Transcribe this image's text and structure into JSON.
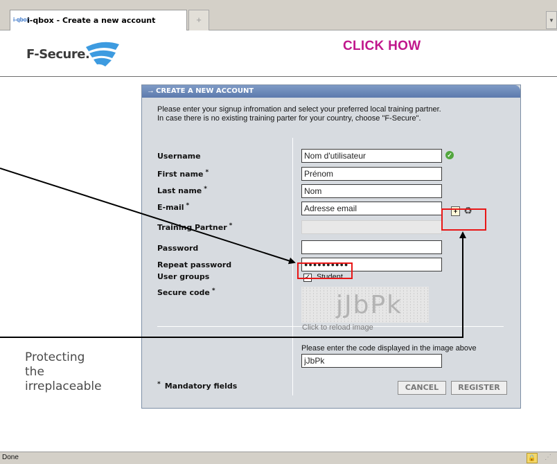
{
  "browser": {
    "tab_title": "i-qbox - Create a new account",
    "tab_favicon": "i-qbox",
    "newtab_icon": "plus-icon",
    "status": "Done"
  },
  "header": {
    "logo": "F-Secure.",
    "heading": "CLICK HOW"
  },
  "tagline": [
    "Protecting",
    "the",
    "irreplaceable"
  ],
  "form": {
    "title": "CREATE A NEW ACCOUNT",
    "intro_lines": [
      "Please enter your signup infromation and select your preferred local training partner.",
      "In case there is no existing training parter for your country, choose \"F-Secure\"."
    ],
    "labels": {
      "username": "Username",
      "first_name": "First name",
      "last_name": "Last name",
      "email": "E-mail",
      "training_partner": "Training Partner",
      "password": "Password",
      "repeat_password": "Repeat password",
      "user_groups": "User groups",
      "secure_code": "Secure code"
    },
    "required_mark": "*",
    "values": {
      "username": "Nom d'utilisateur",
      "first_name": "Prénom",
      "last_name": "Nom",
      "email": "Adresse email",
      "training_partner": "",
      "password": "",
      "repeat_password": "●●●●●●●●●●",
      "secure_code": "jJbPk"
    },
    "student_checked": true,
    "student_label": "Student",
    "captcha_text": "jJbPk",
    "reload_text": "Click to reload image",
    "code_instruction": "Please enter the code displayed in the image above",
    "mandatory_star": "*",
    "mandatory_text": "Mandatory fields",
    "cancel_label": "CANCEL",
    "register_label": "REGISTER"
  },
  "colors": {
    "heading": "#c0178c",
    "panel_bg": "#d7dbe0",
    "panel_head": "#6f8cbd",
    "annotation": "#e81616"
  }
}
